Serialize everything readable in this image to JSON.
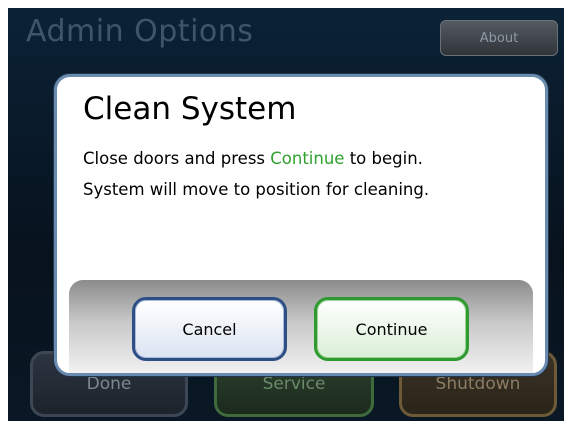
{
  "screen": {
    "title": "Admin Options",
    "about_label": "About"
  },
  "bottom_bar": {
    "done_label": "Done",
    "service_label": "Service",
    "shutdown_label": "Shutdown"
  },
  "dialog": {
    "title": "Clean System",
    "message_line1_prefix": "Close doors and press ",
    "message_line1_highlight": "Continue",
    "message_line1_suffix": " to begin.",
    "message_line2": "System will move to position for cleaning.",
    "cancel_label": "Cancel",
    "continue_label": "Continue"
  },
  "colors": {
    "highlight": "#2fa12f",
    "dialog_border": "#6a8bb0",
    "cancel_border": "#2e4f86",
    "continue_border": "#2f9a2f"
  }
}
